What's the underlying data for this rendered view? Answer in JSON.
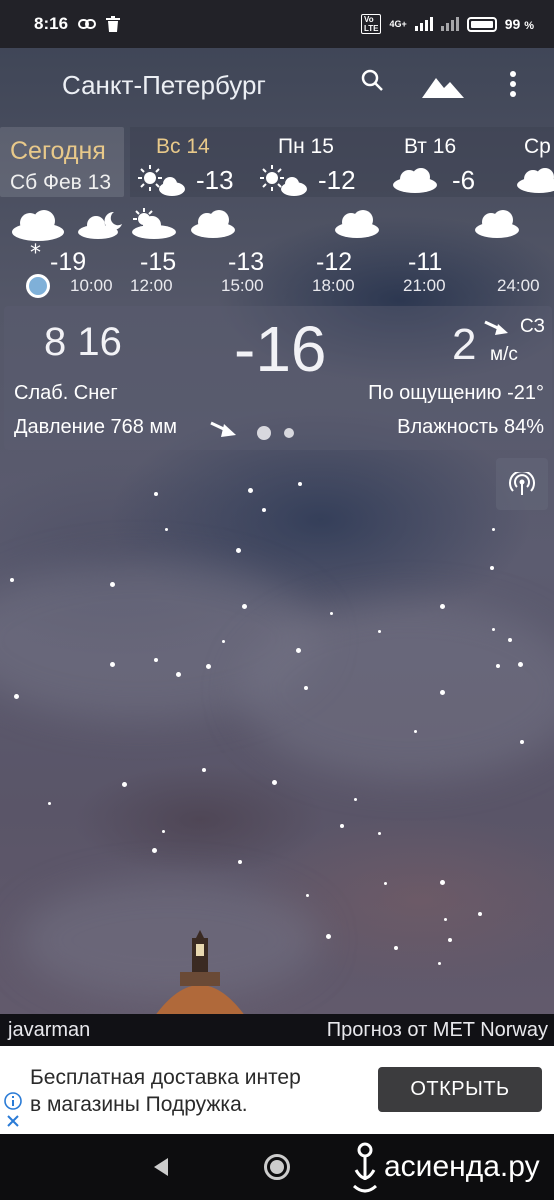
{
  "status_bar": {
    "time": "8:16",
    "network": "4G+",
    "battery": "99",
    "battery_unit": "%"
  },
  "app_bar": {
    "city": "Санкт-Петербург",
    "icons": [
      "search-icon",
      "landscape-icon",
      "more-vert-icon"
    ]
  },
  "days": {
    "today": {
      "label": "Сегодня",
      "date": "Сб Фев 13"
    },
    "items": [
      {
        "name": "Вс 14",
        "temp": "-13",
        "icon": "sun-cloud-icon",
        "highlight": true
      },
      {
        "name": "Пн 15",
        "temp": "-12",
        "icon": "sun-cloud-icon",
        "highlight": false
      },
      {
        "name": "Вт 16",
        "temp": "-6",
        "icon": "cloud-icon",
        "highlight": false
      },
      {
        "name": "Ср",
        "temp": "",
        "icon": "cloud-icon",
        "highlight": false
      }
    ]
  },
  "hourly": [
    {
      "time": "",
      "temp": "-19",
      "icon": "cloud-snow-icon"
    },
    {
      "time": "10:00",
      "temp": "-15",
      "icon": "moon-cloud-icon"
    },
    {
      "time": "12:00",
      "temp": "-13",
      "icon": "sun-cloud-icon"
    },
    {
      "time": "15:00",
      "temp": "-12",
      "icon": "cloud-icon"
    },
    {
      "time": "18:00",
      "temp": "-11",
      "icon": "cloud-icon"
    },
    {
      "time": "21:00",
      "temp": "",
      "icon": "cloud-icon"
    },
    {
      "time": "24:00",
      "temp": "",
      "icon": "cloud-icon"
    }
  ],
  "current": {
    "time": "8 16",
    "temperature": "-16",
    "wind_speed": "2",
    "wind_direction": "СЗ",
    "wind_unit": "м/с",
    "condition": "Слаб. Снег",
    "feels_like": "По ощущению -21°",
    "pressure": "Давление 768 мм",
    "humidity": "Влажность 84%"
  },
  "footer": {
    "author": "javarman",
    "provider": "Прогноз от MET Norway"
  },
  "ad": {
    "text_line1": "Бесплатная доставка интер",
    "text_line2": "в магазины Подружка.",
    "button": "ОТКРЫТЬ"
  },
  "watermark": "асиенда.ру"
}
